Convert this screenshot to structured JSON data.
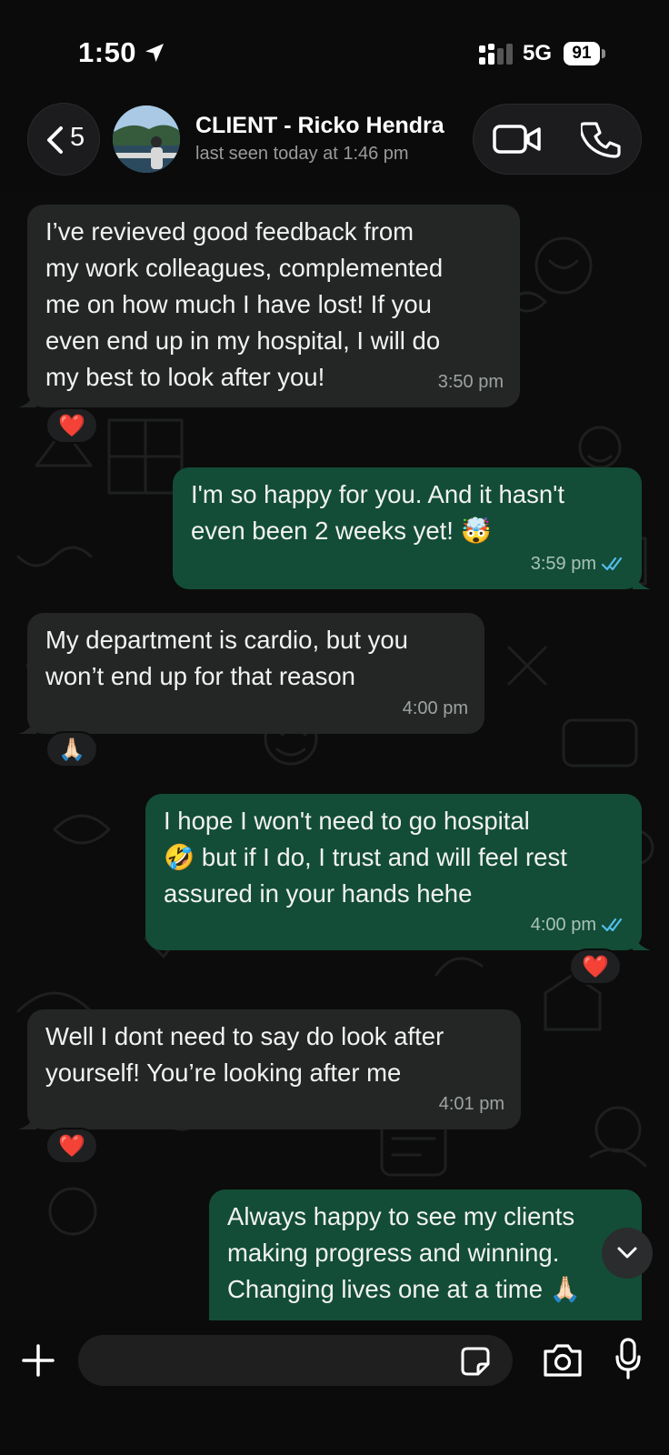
{
  "status_bar": {
    "time": "1:50",
    "network": "5G",
    "battery": "91"
  },
  "header": {
    "back_count": "5",
    "contact_name": "CLIENT - Ricko Hendra",
    "last_seen": "last seen today at 1:46 pm"
  },
  "messages": [
    {
      "direction": "incoming",
      "text": "I’ve revieved good feedback from\nmy work colleagues, complemented\nme on how much I have lost! If you\neven end up in my hospital, I will do\nmy best to look after you!",
      "time": "3:50 pm",
      "reaction": "❤️"
    },
    {
      "direction": "outgoing",
      "text": "I'm so happy for you. And it hasn't\neven been 2 weeks yet! 🤯",
      "time": "3:59 pm",
      "status": "read"
    },
    {
      "direction": "incoming",
      "text": "My department is cardio, but you\nwon’t end up for that reason",
      "time": "4:00 pm",
      "reaction": "🙏🏻"
    },
    {
      "direction": "outgoing",
      "text": "I hope I won't need to go hospital\n🤣 but if I do, I trust and will feel rest\nassured in your hands hehe",
      "time": "4:00 pm",
      "status": "read",
      "reaction": "❤️"
    },
    {
      "direction": "incoming",
      "text": "Well I dont need to say do look after\nyourself! You’re looking after me",
      "time": "4:01 pm",
      "reaction": "❤️"
    },
    {
      "direction": "outgoing",
      "text": "Always happy to see my clients\nmaking progress and winning.\nChanging lives one at a time 🙏🏻",
      "time": ""
    }
  ],
  "composer": {
    "placeholder": ""
  },
  "colors": {
    "incoming_bubble": "#242626",
    "outgoing_bubble": "#134d37",
    "read_ticks": "#53bdeb",
    "background": "#0b0b0b"
  },
  "icons": {
    "location": "location-arrow-icon",
    "signal": "cellular-signal-icon",
    "back": "chevron-left-icon",
    "video": "video-camera-icon",
    "phone": "phone-icon",
    "scroll": "chevron-down-icon",
    "plus": "plus-icon",
    "sticker": "sticker-icon",
    "camera": "camera-icon",
    "mic": "microphone-icon"
  }
}
